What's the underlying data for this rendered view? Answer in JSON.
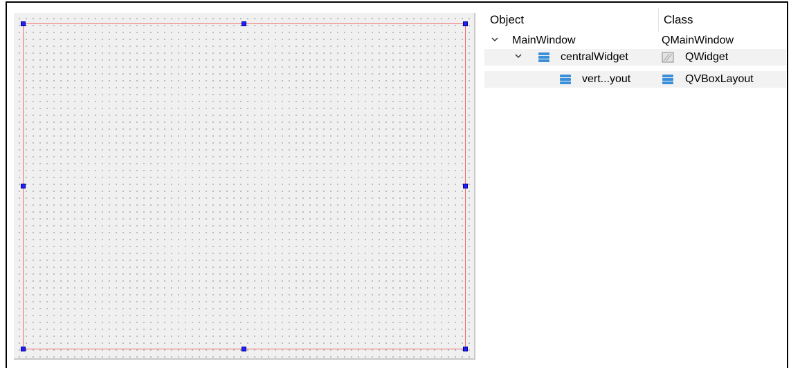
{
  "form": {},
  "inspector": {
    "headers": {
      "object": "Object",
      "class": "Class"
    },
    "rows": [
      {
        "object": "MainWindow",
        "class": "QMainWindow",
        "object_icon": "",
        "class_icon": "",
        "expanded": true
      },
      {
        "object": "centralWidget",
        "class": "QWidget",
        "object_icon": "layout-icon",
        "class_icon": "widget-icon",
        "expanded": true
      },
      {
        "object": "vert...yout",
        "class": "QVBoxLayout",
        "object_icon": "layout-icon",
        "class_icon": "layout-icon"
      }
    ]
  },
  "colors": {
    "layout_border": "#f06a6a",
    "handle": "#1e1eff",
    "layout_icon": "#3a8fd8",
    "canvas": "#f0f0f0"
  }
}
